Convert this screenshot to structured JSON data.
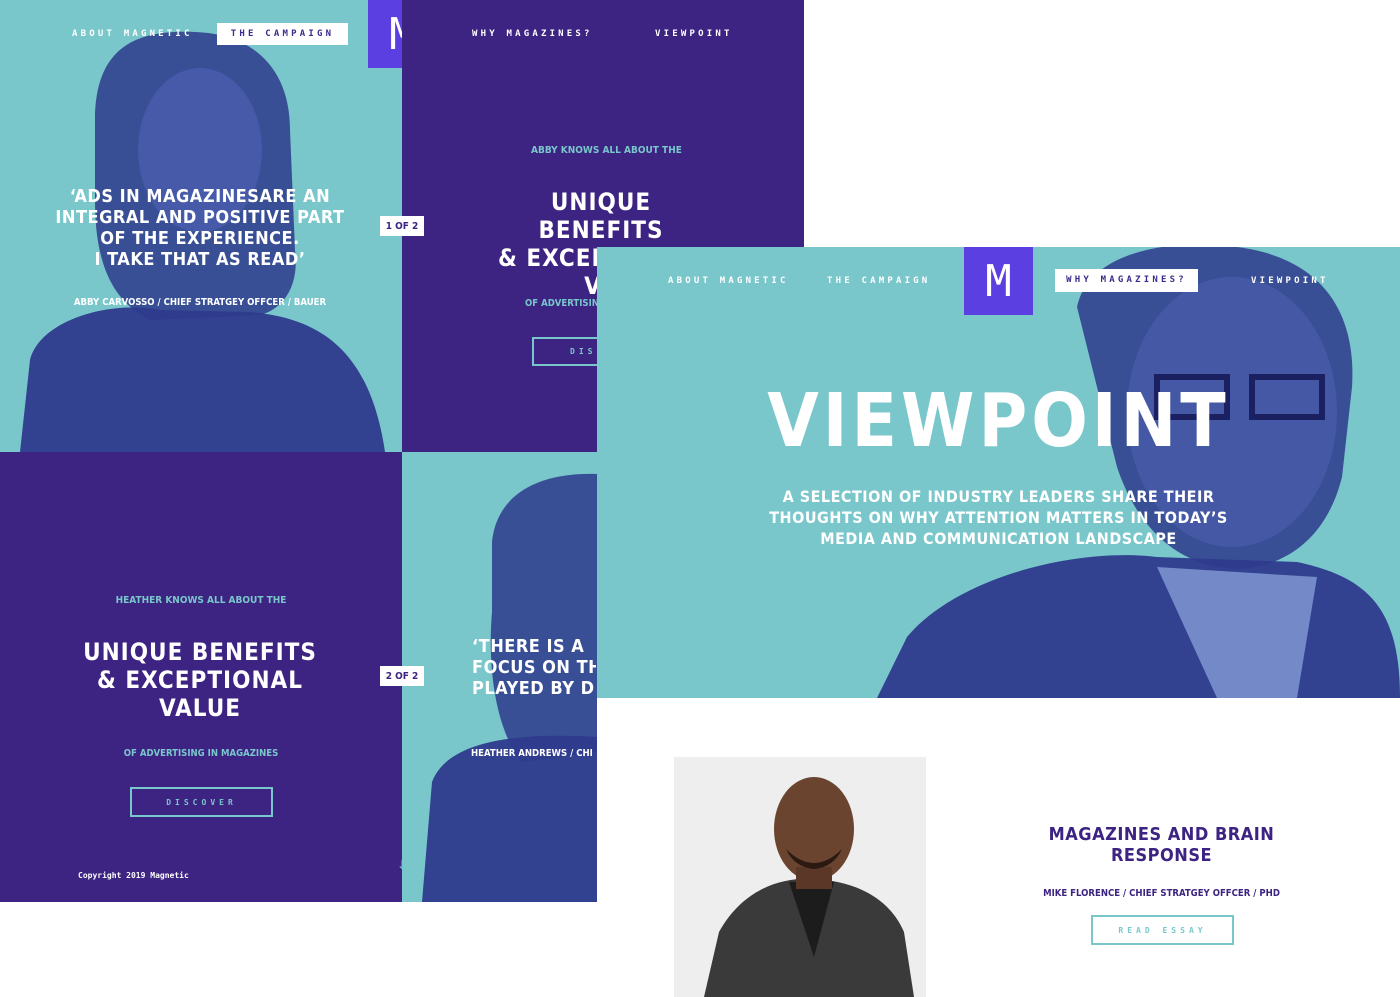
{
  "colors": {
    "teal": "#79c7cb",
    "purple": "#3d2382",
    "logo": "#5b3fe0",
    "duotone_dark": "#2e3a8c",
    "white": "#ffffff"
  },
  "left_nav": {
    "about": "ABOUT MAGNETIC",
    "campaign": "THE CAMPAIGN",
    "why": "WHY MAGAZINES?",
    "viewpoint": "VIEWPOINT",
    "logo_letter": "M"
  },
  "quote1": {
    "text_lines": [
      "‘ADS IN MAGAZINESARE AN",
      "INTEGRAL AND POSITIVE PART",
      "OF THE EXPERIENCE.",
      "I TAKE THAT AS READ’"
    ],
    "author": "ABBY CARVOSSO / CHIEF STRATGEY OFFCER / BAUER"
  },
  "counter1": "1 OF 2",
  "panel_abby": {
    "intro": "ABBY KNOWS ALL ABOUT THE",
    "headline_lines": [
      "UNIQUE BENEFITS",
      "& EXCEPTIONAL",
      "VA"
    ],
    "sub": "OF ADVERTISIN",
    "button": "DISC"
  },
  "panel_heather": {
    "intro": "HEATHER KNOWS ALL ABOUT THE",
    "headline_lines": [
      "UNIQUE BENEFITS",
      "& EXCEPTIONAL",
      "VALUE"
    ],
    "sub": "OF ADVERTISING IN MAGAZINES",
    "button": "DISCOVER",
    "copyright": "Copyright 2019 Magnetic"
  },
  "counter2": "2 OF 2",
  "quote2": {
    "text_lines": [
      "‘THERE IS A",
      "FOCUS ON THE",
      "PLAYED BY DIF"
    ],
    "author": "HEATHER ANDREWS / CHI"
  },
  "right_nav": {
    "about": "ABOUT MAGNETIC",
    "campaign": "THE CAMPAIGN",
    "why": "WHY MAGAZINES?",
    "viewpoint": "VIEWPOINT",
    "logo_letter": "M"
  },
  "hero": {
    "title": "VIEWPOINT",
    "subtitle_lines": [
      "A SELECTION OF INDUSTRY LEADERS SHARE THEIR",
      "THOUGHTS ON WHY ATTENTION MATTERS IN TODAY’S",
      "MEDIA AND COMMUNICATION LANDSCAPE"
    ]
  },
  "essay": {
    "title_lines": [
      "MAGAZINES AND BRAIN",
      "RESPONSE"
    ],
    "author": "MIKE FLORENCE / CHIEF STRATGEY OFFCER / PHD",
    "button": "READ ESSAY"
  }
}
